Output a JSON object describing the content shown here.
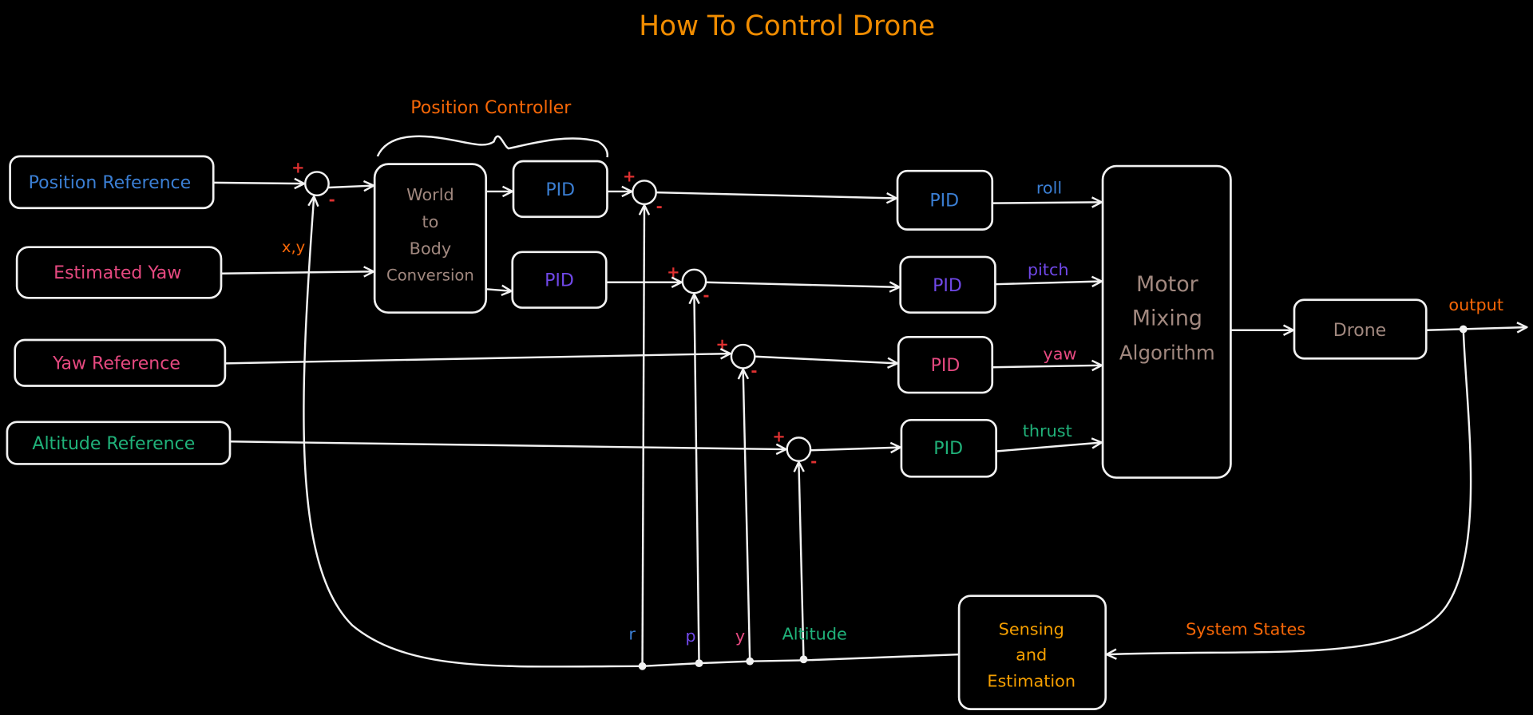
{
  "title": "How To Control Drone",
  "group_label": "Position Controller",
  "inputs": {
    "position_reference": "Position Reference",
    "estimated_yaw": "Estimated Yaw",
    "yaw_reference": "Yaw Reference",
    "altitude_reference": "Altitude Reference"
  },
  "blocks": {
    "world_to_body": [
      "World",
      "to",
      "Body",
      "Conversion"
    ],
    "pid_label": "PID",
    "motor_mixing": [
      "Motor",
      "Mixing",
      "Algorithm"
    ],
    "drone": "Drone",
    "sensing": [
      "Sensing",
      "and",
      "Estimation"
    ]
  },
  "signals": {
    "xy": "x,y",
    "roll": "roll",
    "pitch": "pitch",
    "yaw": "yaw",
    "thrust": "thrust",
    "output": "output",
    "system_states": "System States",
    "r": "r",
    "p": "p",
    "y": "y",
    "altitude": "Altitude",
    "plus": "+",
    "minus": "-"
  },
  "colors": {
    "background": "#000000",
    "stroke": "#f2f2f2",
    "title": "#f08c00",
    "orange_label": "#f76707",
    "blue": "#3b7fd4",
    "pink": "#e64980",
    "purple": "#7048e8",
    "green": "#20b27a",
    "brown": "#a1887f",
    "sensing": "#f59f00",
    "sign_red": "#e03131"
  }
}
